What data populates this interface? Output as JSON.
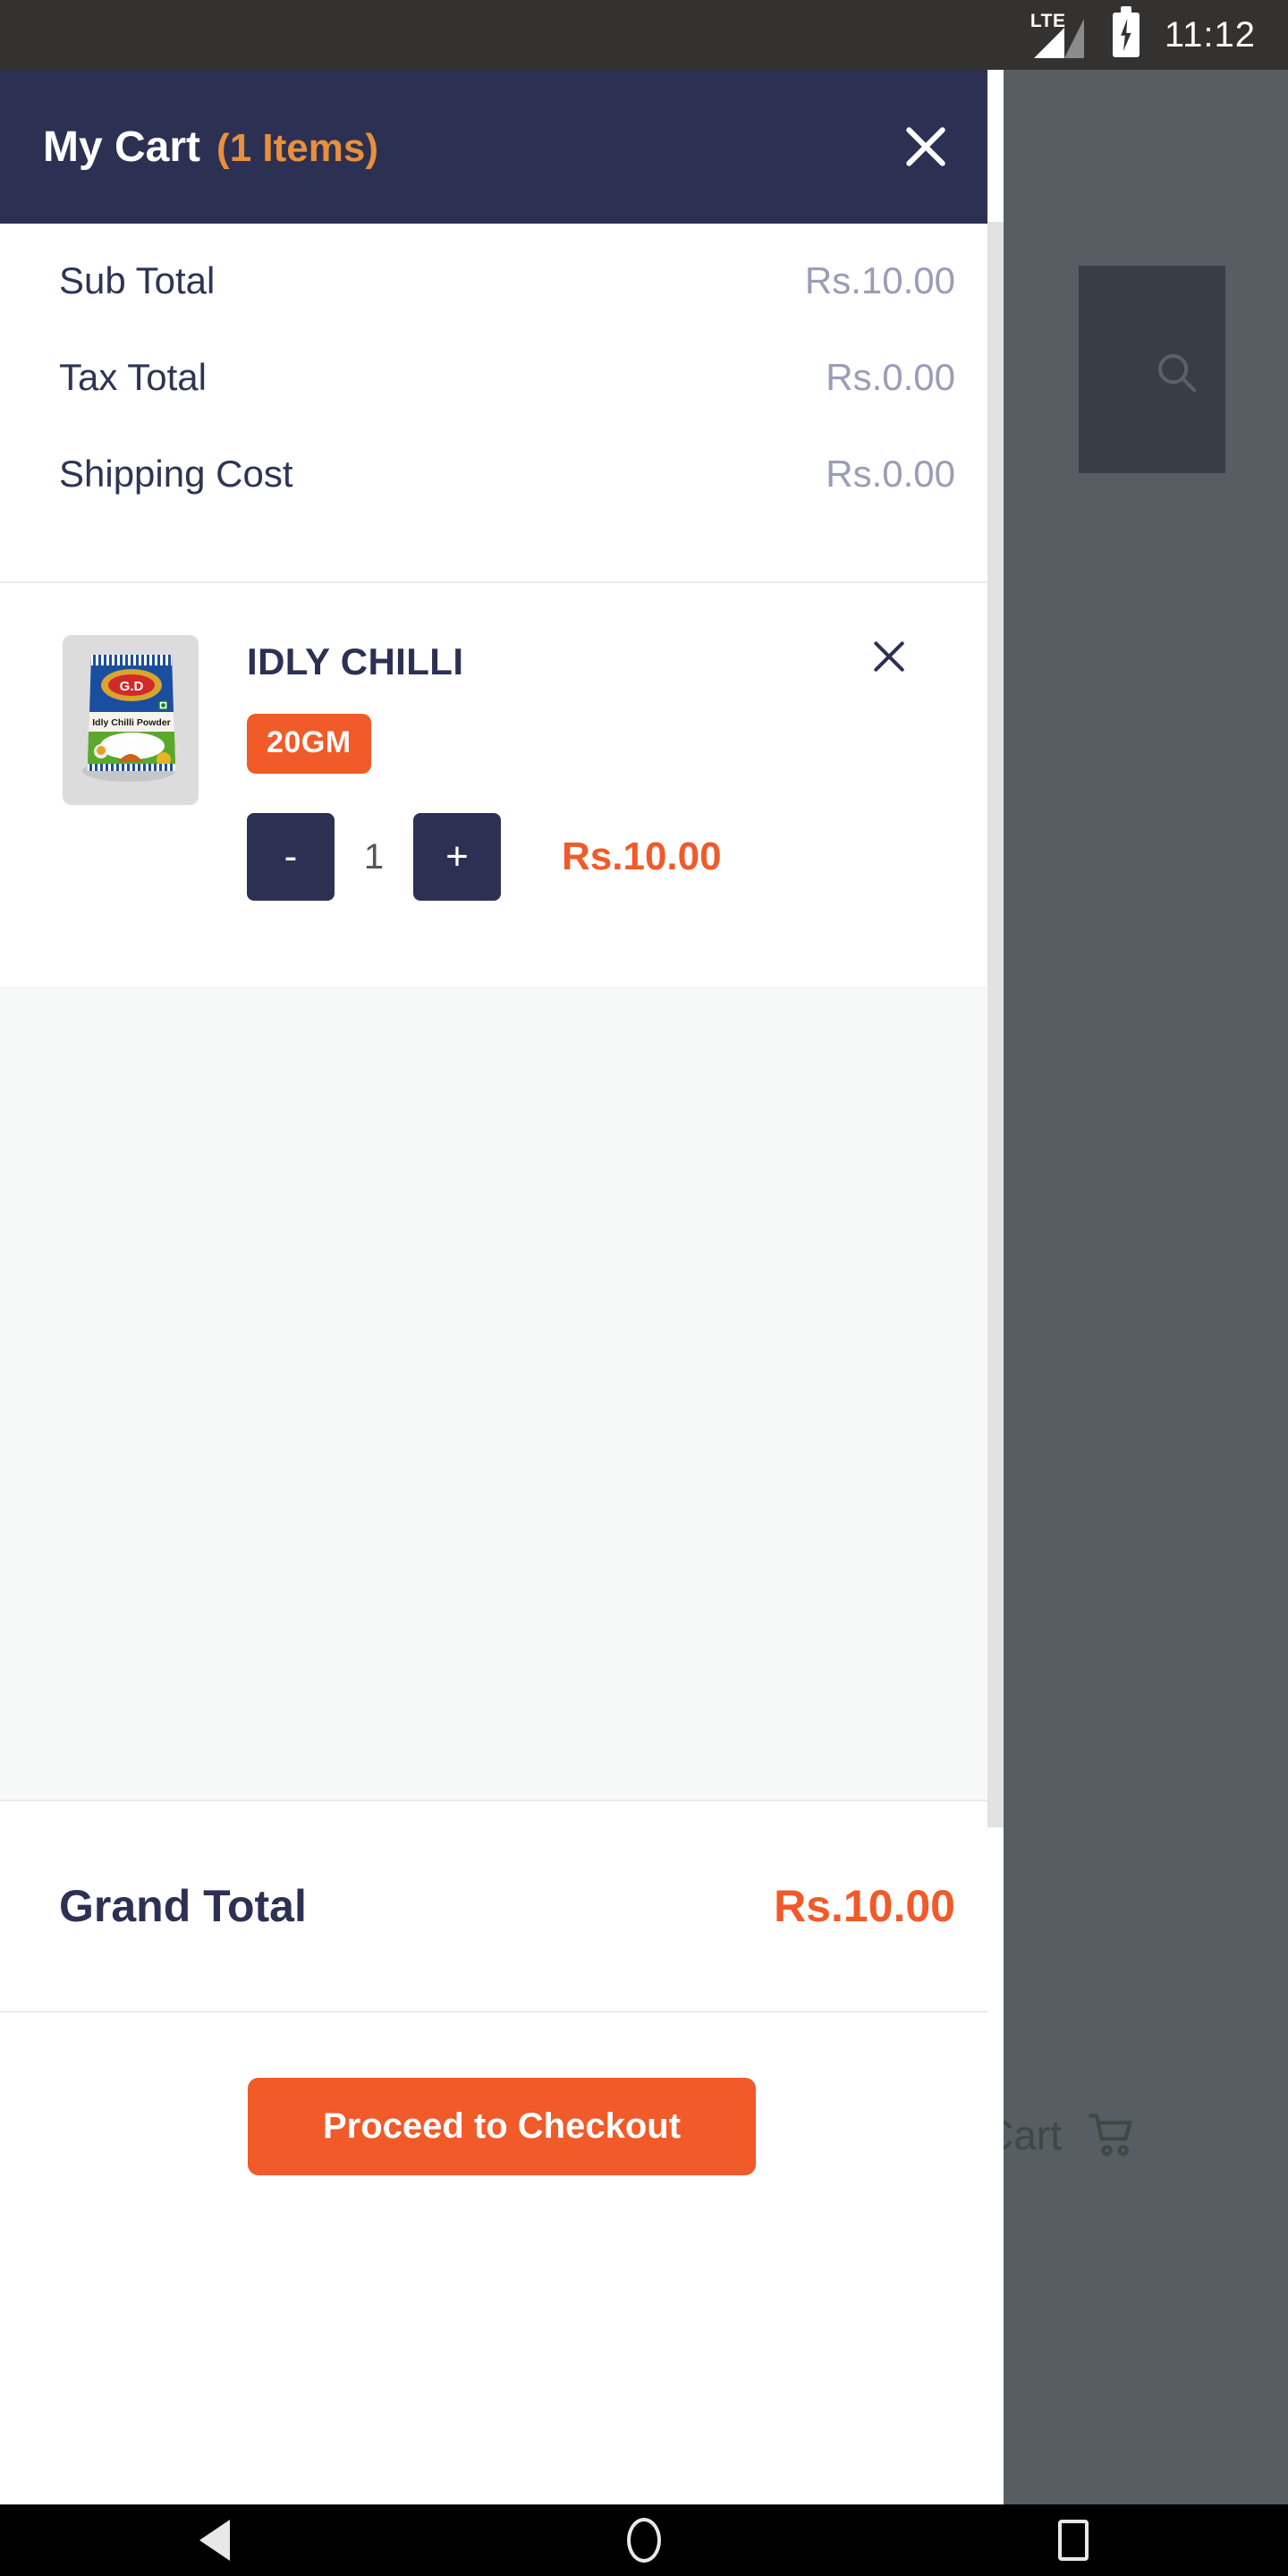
{
  "status_bar": {
    "network_type": "LTE",
    "clock": "11:12",
    "battery_icon": "battery-charging-icon",
    "signal_icon": "signal-bars-icon"
  },
  "background_app": {
    "cart_label": "Cart",
    "cart_icon": "shopping-cart-icon",
    "search_icon": "search-icon"
  },
  "cart": {
    "header": {
      "title": "My Cart",
      "item_count_label": "(1 Items)",
      "close_icon": "close-icon"
    },
    "summary": [
      {
        "label": "Sub Total",
        "value": "Rs.10.00"
      },
      {
        "label": "Tax Total",
        "value": "Rs.0.00"
      },
      {
        "label": "Shipping Cost",
        "value": "Rs.0.00"
      }
    ],
    "items": [
      {
        "name": "IDLY CHILLI",
        "variant": "20GM",
        "quantity": "1",
        "price": "Rs.10.00",
        "decrement_label": "-",
        "increment_label": "+",
        "remove_icon": "close-icon",
        "image_brand": "G.D",
        "image_product_text": "Idly Chilli Powder"
      }
    ],
    "grand_total": {
      "label": "Grand Total",
      "value": "Rs.10.00"
    },
    "checkout_label": "Proceed to Checkout"
  },
  "nav_bar": {
    "back_icon": "back-triangle-icon",
    "home_icon": "home-circle-icon",
    "recents_icon": "recents-square-icon"
  },
  "colors": {
    "header_navy": "#2c3154",
    "accent_orange": "#f15a29",
    "count_orange": "#e8903a",
    "muted_value": "#9a9db5",
    "scrim": "#565d63"
  }
}
